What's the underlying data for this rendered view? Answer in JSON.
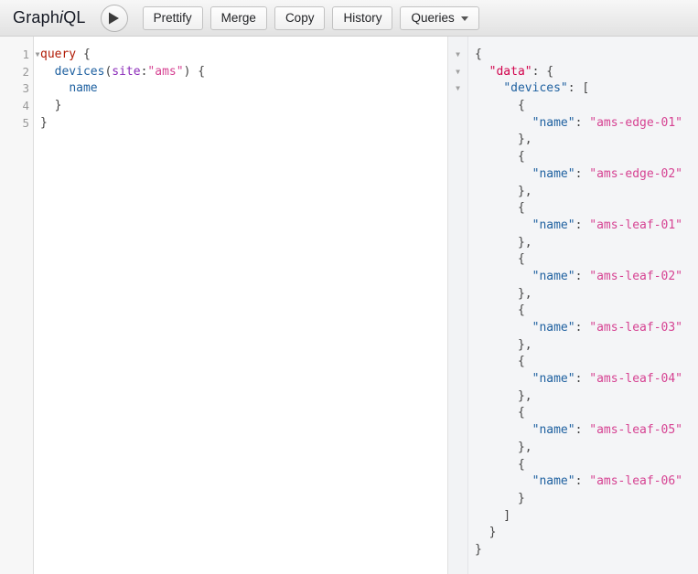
{
  "app": {
    "logo_prefix": "Graph",
    "logo_italic": "i",
    "logo_suffix": "QL",
    "title": "GraphiQL"
  },
  "toolbar": {
    "execute_button_label": "Execute Query",
    "execute_icon": "play-icon",
    "buttons": [
      {
        "label": "Prettify",
        "name": "prettify-button"
      },
      {
        "label": "Merge",
        "name": "merge-button"
      },
      {
        "label": "Copy",
        "name": "copy-button"
      },
      {
        "label": "History",
        "name": "history-button"
      }
    ],
    "dropdown": {
      "label": "Queries",
      "name": "queries-dropdown",
      "caret": "chevron-down-icon"
    }
  },
  "query_editor": {
    "name": "query-editor",
    "line_numbers": [
      "1",
      "2",
      "3",
      "4",
      "5"
    ],
    "fold_markers": [
      true,
      false,
      false,
      false,
      false
    ],
    "lines": [
      [
        {
          "text": "query",
          "cls": "t-kw"
        },
        {
          "text": " ",
          "cls": "t-punc"
        },
        {
          "text": "{",
          "cls": "t-brace"
        }
      ],
      [
        {
          "text": "  ",
          "cls": "t-punc"
        },
        {
          "text": "devices",
          "cls": "t-field"
        },
        {
          "text": "(",
          "cls": "t-brace"
        },
        {
          "text": "site",
          "cls": "t-arg"
        },
        {
          "text": ":",
          "cls": "t-brace"
        },
        {
          "text": "\"ams\"",
          "cls": "t-str"
        },
        {
          "text": ")",
          "cls": "t-brace"
        },
        {
          "text": " ",
          "cls": "t-punc"
        },
        {
          "text": "{",
          "cls": "t-brace"
        }
      ],
      [
        {
          "text": "    ",
          "cls": "t-punc"
        },
        {
          "text": "name",
          "cls": "t-field"
        }
      ],
      [
        {
          "text": "  ",
          "cls": "t-punc"
        },
        {
          "text": "}",
          "cls": "t-brace"
        }
      ],
      [
        {
          "text": "}",
          "cls": "t-brace"
        }
      ]
    ],
    "plain_text": "query {\n  devices(site:\"ams\") {\n    name\n  }\n}"
  },
  "result_viewer": {
    "name": "result-viewer",
    "fold_markers": [
      true,
      true,
      true
    ],
    "lines": [
      [
        {
          "text": "{",
          "cls": "t-brace"
        }
      ],
      [
        {
          "text": "  ",
          "cls": "t-punc"
        },
        {
          "text": "\"data\"",
          "cls": "t-def"
        },
        {
          "text": ": ",
          "cls": "t-brace"
        },
        {
          "text": "{",
          "cls": "t-brace"
        }
      ],
      [
        {
          "text": "    ",
          "cls": "t-punc"
        },
        {
          "text": "\"devices\"",
          "cls": "t-key"
        },
        {
          "text": ": ",
          "cls": "t-brace"
        },
        {
          "text": "[",
          "cls": "t-brace"
        }
      ],
      [
        {
          "text": "      {",
          "cls": "t-brace"
        }
      ],
      [
        {
          "text": "        ",
          "cls": "t-punc"
        },
        {
          "text": "\"name\"",
          "cls": "t-key"
        },
        {
          "text": ": ",
          "cls": "t-brace"
        },
        {
          "text": "\"ams-edge-01\"",
          "cls": "t-str"
        }
      ],
      [
        {
          "text": "      },",
          "cls": "t-brace"
        }
      ],
      [
        {
          "text": "      {",
          "cls": "t-brace"
        }
      ],
      [
        {
          "text": "        ",
          "cls": "t-punc"
        },
        {
          "text": "\"name\"",
          "cls": "t-key"
        },
        {
          "text": ": ",
          "cls": "t-brace"
        },
        {
          "text": "\"ams-edge-02\"",
          "cls": "t-str"
        }
      ],
      [
        {
          "text": "      },",
          "cls": "t-brace"
        }
      ],
      [
        {
          "text": "      {",
          "cls": "t-brace"
        }
      ],
      [
        {
          "text": "        ",
          "cls": "t-punc"
        },
        {
          "text": "\"name\"",
          "cls": "t-key"
        },
        {
          "text": ": ",
          "cls": "t-brace"
        },
        {
          "text": "\"ams-leaf-01\"",
          "cls": "t-str"
        }
      ],
      [
        {
          "text": "      },",
          "cls": "t-brace"
        }
      ],
      [
        {
          "text": "      {",
          "cls": "t-brace"
        }
      ],
      [
        {
          "text": "        ",
          "cls": "t-punc"
        },
        {
          "text": "\"name\"",
          "cls": "t-key"
        },
        {
          "text": ": ",
          "cls": "t-brace"
        },
        {
          "text": "\"ams-leaf-02\"",
          "cls": "t-str"
        }
      ],
      [
        {
          "text": "      },",
          "cls": "t-brace"
        }
      ],
      [
        {
          "text": "      {",
          "cls": "t-brace"
        }
      ],
      [
        {
          "text": "        ",
          "cls": "t-punc"
        },
        {
          "text": "\"name\"",
          "cls": "t-key"
        },
        {
          "text": ": ",
          "cls": "t-brace"
        },
        {
          "text": "\"ams-leaf-03\"",
          "cls": "t-str"
        }
      ],
      [
        {
          "text": "      },",
          "cls": "t-brace"
        }
      ],
      [
        {
          "text": "      {",
          "cls": "t-brace"
        }
      ],
      [
        {
          "text": "        ",
          "cls": "t-punc"
        },
        {
          "text": "\"name\"",
          "cls": "t-key"
        },
        {
          "text": ": ",
          "cls": "t-brace"
        },
        {
          "text": "\"ams-leaf-04\"",
          "cls": "t-str"
        }
      ],
      [
        {
          "text": "      },",
          "cls": "t-brace"
        }
      ],
      [
        {
          "text": "      {",
          "cls": "t-brace"
        }
      ],
      [
        {
          "text": "        ",
          "cls": "t-punc"
        },
        {
          "text": "\"name\"",
          "cls": "t-key"
        },
        {
          "text": ": ",
          "cls": "t-brace"
        },
        {
          "text": "\"ams-leaf-05\"",
          "cls": "t-str"
        }
      ],
      [
        {
          "text": "      },",
          "cls": "t-brace"
        }
      ],
      [
        {
          "text": "      {",
          "cls": "t-brace"
        }
      ],
      [
        {
          "text": "        ",
          "cls": "t-punc"
        },
        {
          "text": "\"name\"",
          "cls": "t-key"
        },
        {
          "text": ": ",
          "cls": "t-brace"
        },
        {
          "text": "\"ams-leaf-06\"",
          "cls": "t-str"
        }
      ],
      [
        {
          "text": "      }",
          "cls": "t-brace"
        }
      ],
      [
        {
          "text": "    ]",
          "cls": "t-brace"
        }
      ],
      [
        {
          "text": "  }",
          "cls": "t-brace"
        }
      ],
      [
        {
          "text": "}",
          "cls": "t-brace"
        }
      ]
    ],
    "device_names": [
      "ams-edge-01",
      "ams-edge-02",
      "ams-leaf-01",
      "ams-leaf-02",
      "ams-leaf-03",
      "ams-leaf-04",
      "ams-leaf-05",
      "ams-leaf-06"
    ],
    "root_key": "data",
    "collection_key": "devices",
    "field_key": "name"
  },
  "colors": {
    "keyword": "#b11a04",
    "field": "#1f61a0",
    "argument": "#8b2bb9",
    "string": "#d64292",
    "def": "#d2054e",
    "punctuation": "#555555",
    "toolbar_bg": "#e6e6e6",
    "query_bg": "#ffffff",
    "result_bg": "#f4f5f7",
    "gutter_bg": "#f7f7f7"
  }
}
